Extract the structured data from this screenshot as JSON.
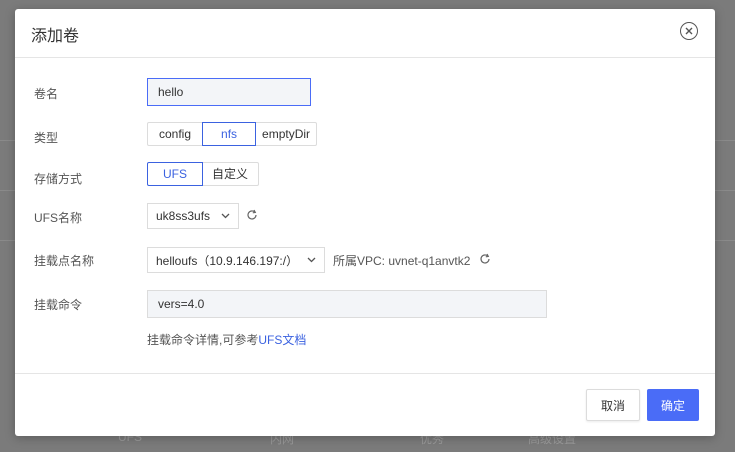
{
  "background": {
    "footer_texts": [
      "UFS",
      "内网",
      "优秀",
      "高级设置"
    ]
  },
  "dialog": {
    "title": "添加卷",
    "close_icon": "close-circle-icon"
  },
  "form": {
    "volume_name": {
      "label": "卷名",
      "value": "hello"
    },
    "type": {
      "label": "类型",
      "options": [
        "config",
        "nfs",
        "emptyDir"
      ],
      "selected": "nfs"
    },
    "storage": {
      "label": "存储方式",
      "options": [
        "UFS",
        "自定义"
      ],
      "selected": "UFS"
    },
    "ufs_name": {
      "label": "UFS名称",
      "value": "uk8ss3ufs"
    },
    "mount_point": {
      "label": "挂载点名称",
      "value": "helloufs（10.9.146.197:/）",
      "vpc_text": "所属VPC: uvnet-q1anvtk2"
    },
    "mount_cmd": {
      "label": "挂载命令",
      "value": "vers=4.0"
    },
    "hint": {
      "prefix": "挂载命令详情,可参考",
      "link": "UFS文档"
    }
  },
  "footer": {
    "cancel_label": "取消",
    "ok_label": "确定"
  },
  "colors": {
    "accent": "#4a6cf7",
    "active_border": "#3b62e0"
  }
}
